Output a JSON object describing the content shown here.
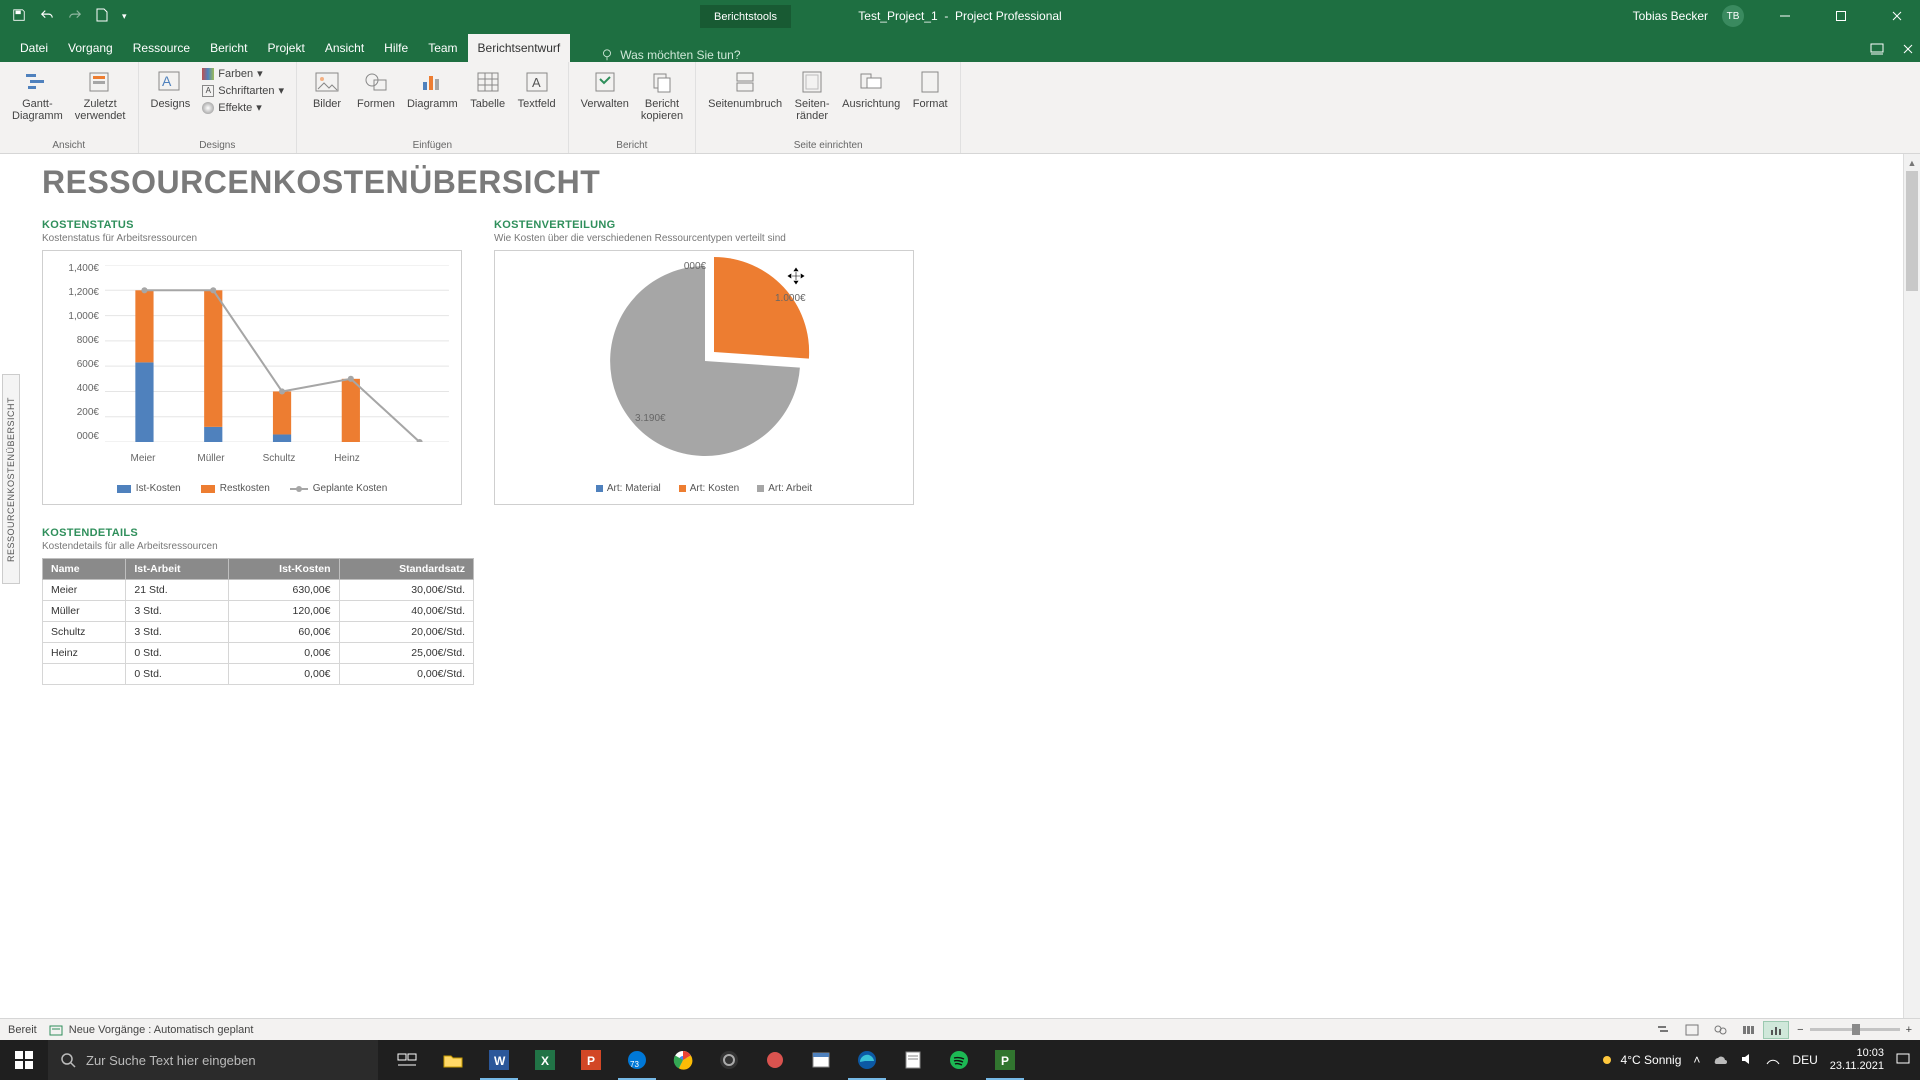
{
  "titlebar": {
    "tooltab": "Berichtstools",
    "doc": "Test_Project_1",
    "app": "Project Professional",
    "user": "Tobias Becker",
    "initials": "TB"
  },
  "tabs": {
    "items": [
      "Datei",
      "Vorgang",
      "Ressource",
      "Bericht",
      "Projekt",
      "Ansicht",
      "Hilfe",
      "Team",
      "Berichtsentwurf"
    ],
    "active": 8,
    "tellme": "Was möchten Sie tun?"
  },
  "ribbon": {
    "groups": {
      "ansicht": {
        "label": "Ansicht",
        "gantt": "Gantt-\nDiagramm",
        "zuletzt": "Zuletzt\nverwendet"
      },
      "designs": {
        "label": "Designs",
        "designs": "Designs",
        "farben": "Farben",
        "schriftarten": "Schriftarten",
        "effekte": "Effekte"
      },
      "einfugen": {
        "label": "Einfügen",
        "bilder": "Bilder",
        "formen": "Formen",
        "diagramm": "Diagramm",
        "tabelle": "Tabelle",
        "textfeld": "Textfeld"
      },
      "bericht": {
        "label": "Bericht",
        "verwalten": "Verwalten",
        "kopieren": "Bericht\nkopieren"
      },
      "seite": {
        "label": "Seite einrichten",
        "umbruch": "Seitenumbruch",
        "rander": "Seiten-\nränder",
        "ausrichtung": "Ausrichtung",
        "format": "Format"
      }
    }
  },
  "sidetab": "RESSOURCENKOSTENÜBERSICHT",
  "report": {
    "title": "RESSOURCENKOSTENÜBERSICHT",
    "status": {
      "title": "KOSTENSTATUS",
      "sub": "Kostenstatus für Arbeitsressourcen"
    },
    "dist": {
      "title": "KOSTENVERTEILUNG",
      "sub": "Wie Kosten über die verschiedenen Ressourcentypen verteilt sind"
    },
    "details": {
      "title": "KOSTENDETAILS",
      "sub": "Kostendetails für alle Arbeitsressourcen"
    }
  },
  "chart_data": [
    {
      "type": "bar",
      "title": "Kostenstatus",
      "categories": [
        "Meier",
        "Müller",
        "Schultz",
        "Heinz"
      ],
      "series": [
        {
          "name": "Ist-Kosten",
          "values": [
            630,
            120,
            60,
            0
          ],
          "color": "#4f81bd",
          "kind": "bar"
        },
        {
          "name": "Restkosten",
          "values": [
            570,
            1080,
            340,
            500
          ],
          "color": "#ed7d31",
          "kind": "bar-stacked"
        },
        {
          "name": "Geplante Kosten",
          "values": [
            1200,
            1200,
            400,
            500,
            0
          ],
          "x": [
            "Meier",
            "Müller",
            "Schultz",
            "Heinz",
            ""
          ],
          "color": "#a6a6a6",
          "kind": "line"
        }
      ],
      "ylabel": "",
      "xlabel": "",
      "yticks": [
        "000€",
        "200€",
        "400€",
        "600€",
        "800€",
        "1,000€",
        "1,200€",
        "1,400€"
      ],
      "ylim": [
        0,
        1400
      ]
    },
    {
      "type": "pie",
      "title": "Kostenverteilung",
      "series": [
        {
          "name": "Art: Material",
          "value": 0,
          "label": "000€",
          "color": "#4f81bd"
        },
        {
          "name": "Art: Kosten",
          "value": 1000,
          "label": "1.000€",
          "color": "#ed7d31"
        },
        {
          "name": "Art: Arbeit",
          "value": 3190,
          "label": "3.190€",
          "color": "#a6a6a6"
        }
      ]
    }
  ],
  "table": {
    "headers": [
      "Name",
      "Ist-Arbeit",
      "Ist-Kosten",
      "Standardsatz"
    ],
    "rows": [
      [
        "Meier",
        "21 Std.",
        "630,00€",
        "30,00€/Std."
      ],
      [
        "Müller",
        "3 Std.",
        "120,00€",
        "40,00€/Std."
      ],
      [
        "Schultz",
        "3 Std.",
        "60,00€",
        "20,00€/Std."
      ],
      [
        "Heinz",
        "0 Std.",
        "0,00€",
        "25,00€/Std."
      ],
      [
        "",
        "0 Std.",
        "0,00€",
        "0,00€/Std."
      ]
    ]
  },
  "statusbar": {
    "ready": "Bereit",
    "mode": "Neue Vorgänge : Automatisch geplant"
  },
  "taskbar": {
    "searchPlaceholder": "Zur Suche Text hier eingeben",
    "weather": "4°C  Sonnig",
    "lang": "DEU",
    "time": "10:03",
    "date": "23.11.2021"
  }
}
